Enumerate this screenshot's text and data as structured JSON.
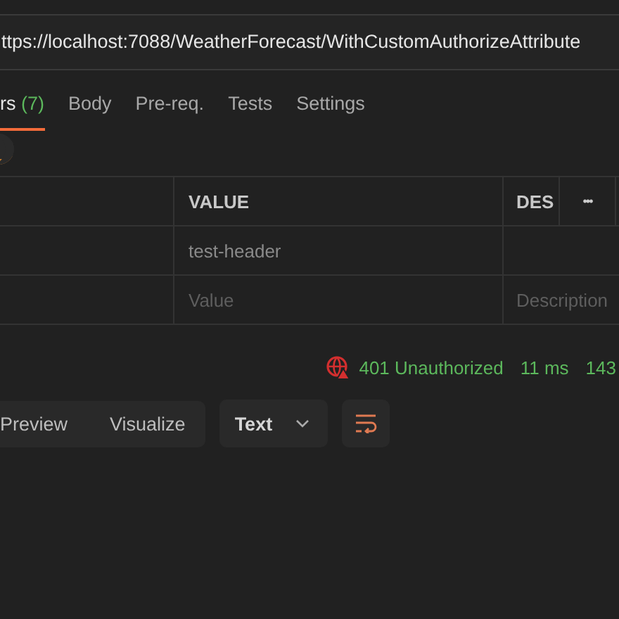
{
  "url_bar": {
    "value": "ttps://localhost:7088/WeatherForecast/WithCustomAuthorizeAttribute"
  },
  "tabs": [
    {
      "label": "rs",
      "count": "(7)",
      "selected": true
    },
    {
      "label": "Body",
      "selected": false
    },
    {
      "label": "Pre-req.",
      "selected": false
    },
    {
      "label": "Tests",
      "selected": false
    },
    {
      "label": "Settings",
      "selected": false
    }
  ],
  "table": {
    "columns": [
      "VALUE",
      "DES"
    ],
    "more": "•••",
    "rows": [
      {
        "value": "test-header",
        "placeholder": false,
        "description": ""
      },
      {
        "value": "Value",
        "placeholder": true,
        "description": "Description"
      }
    ]
  },
  "status": {
    "code": "401 Unauthorized",
    "time": "11 ms",
    "size": "143"
  },
  "view_tabs": [
    {
      "label": "Preview"
    },
    {
      "label": "Visualize"
    }
  ],
  "format": {
    "value": "Text"
  }
}
